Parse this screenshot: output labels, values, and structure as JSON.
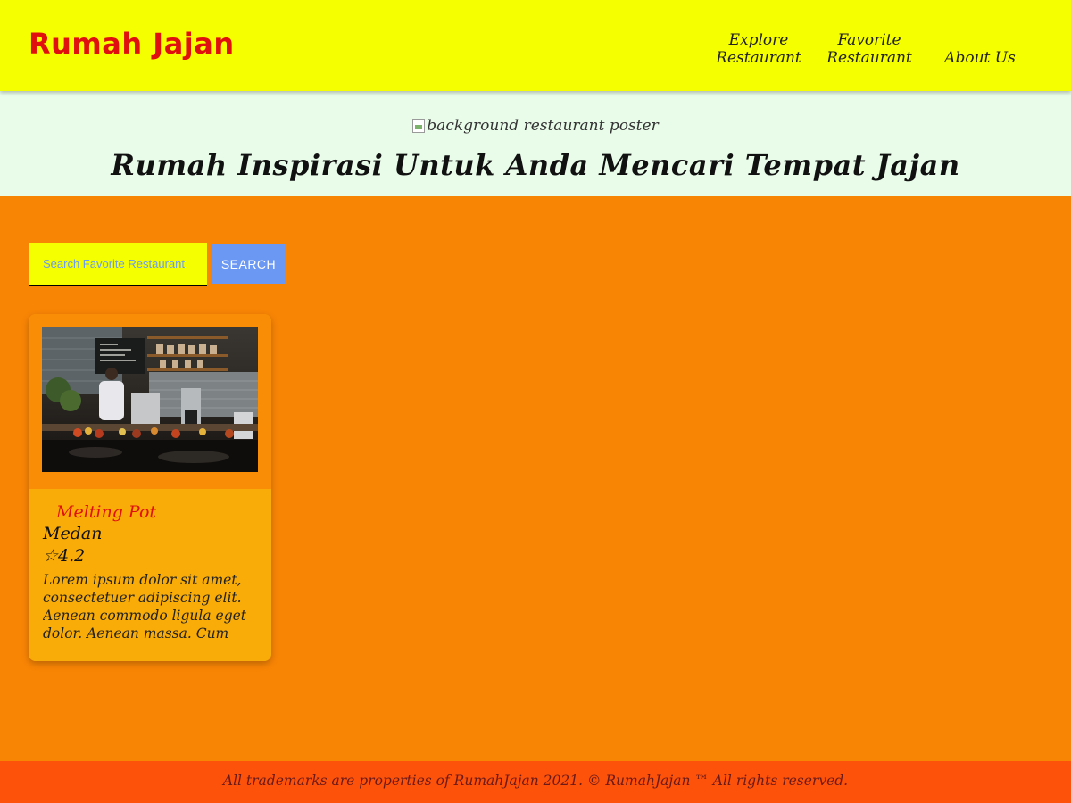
{
  "header": {
    "brand": "Rumah Jajan",
    "nav": [
      {
        "line1": "Explore",
        "line2": "Restaurant"
      },
      {
        "line1": "Favorite",
        "line2": "Restaurant"
      },
      {
        "line1": "",
        "line2": "About Us"
      }
    ]
  },
  "hero": {
    "image_alt": "background restaurant poster",
    "title": "Rumah Inspirasi Untuk Anda Mencari Tempat Jajan"
  },
  "search": {
    "placeholder": "Search Favorite Restaurant",
    "button_label": "SEARCH"
  },
  "restaurants": [
    {
      "name": "Melting Pot",
      "city": "Medan",
      "rating": "☆4.2",
      "description": "Lorem ipsum dolor sit amet, consectetuer adipiscing elit. Aenean commodo ligula eget dolor. Aenean massa. Cum soci..."
    }
  ],
  "footer": {
    "text": "All trademarks are properties of RumahJajan 2021. © RumahJajan ™ All rights reserved."
  },
  "colors": {
    "header_bg": "#f6ff00",
    "brand": "#e0100e",
    "hero_bg": "#e9fbe9",
    "page_bg": "#f98505",
    "card_body": "#f9ac08",
    "search_button": "#6b98f2",
    "footer_bg": "#fd520a"
  }
}
